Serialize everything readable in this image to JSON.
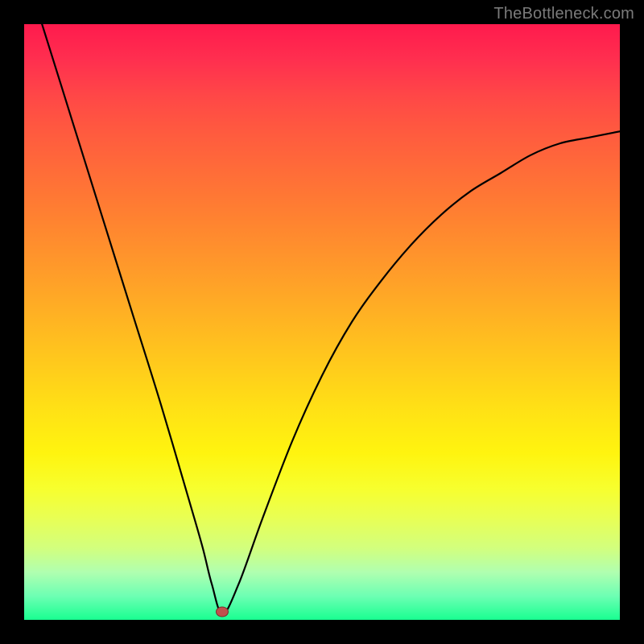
{
  "watermark": "TheBottleneck.com",
  "marker": {
    "x_frac": 0.333,
    "y_frac": 0.987
  },
  "chart_data": {
    "type": "line",
    "title": "",
    "xlabel": "",
    "ylabel": "",
    "xlim": [
      0,
      1
    ],
    "ylim": [
      0,
      1
    ],
    "grid": false,
    "legend": false,
    "series": [
      {
        "name": "bottleneck-curve",
        "x": [
          0.03,
          0.08,
          0.13,
          0.18,
          0.23,
          0.28,
          0.3,
          0.315,
          0.333,
          0.36,
          0.4,
          0.45,
          0.5,
          0.55,
          0.6,
          0.65,
          0.7,
          0.75,
          0.8,
          0.85,
          0.9,
          0.95,
          1.0
        ],
        "y": [
          1.0,
          0.84,
          0.68,
          0.52,
          0.36,
          0.19,
          0.12,
          0.06,
          0.01,
          0.06,
          0.17,
          0.3,
          0.41,
          0.5,
          0.57,
          0.63,
          0.68,
          0.72,
          0.75,
          0.78,
          0.8,
          0.81,
          0.82
        ]
      }
    ],
    "annotations": [
      {
        "type": "marker",
        "x": 0.333,
        "y": 0.013,
        "label": "optimal-point"
      }
    ],
    "background_gradient": {
      "top": "#ff1a4d",
      "mid": "#ffe215",
      "bottom": "#19ff91"
    }
  }
}
